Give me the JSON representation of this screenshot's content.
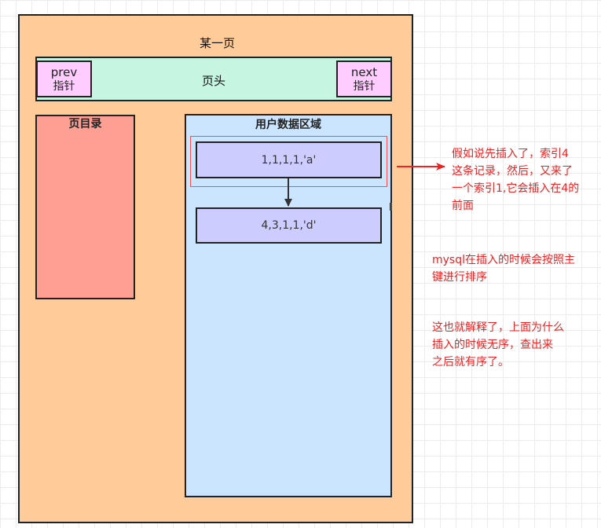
{
  "page": {
    "title": "某一页"
  },
  "header": {
    "label": "页头",
    "prev": {
      "name": "prev",
      "sub": "指针"
    },
    "next": {
      "name": "next",
      "sub": "指针"
    }
  },
  "directory": {
    "label": "页目录"
  },
  "user_area": {
    "label": "用户数据区域",
    "records": [
      "1,1,1,1,'a'",
      "4,3,1,1,'d'"
    ]
  },
  "notes": [
    {
      "lines": [
        "假如说先插入了，索引4",
        "这条记录，然后，又来了",
        "一个索引1,它会插入在4的",
        "前面"
      ]
    },
    {
      "lines": [
        "mysql在插入的时候会按照主",
        "键进行排序"
      ]
    },
    {
      "lines": [
        "这也就解释了，上面为什么",
        "插入的时候无序，查出来",
        "之后就有序了。"
      ]
    }
  ],
  "colors": {
    "page": "#ffcc99",
    "header": "#c6f5e1",
    "pointer": "#ffccff",
    "directory": "#ff9f94",
    "user_area": "#cce5ff",
    "record": "#ccccff",
    "annotation": "#ee2222"
  }
}
